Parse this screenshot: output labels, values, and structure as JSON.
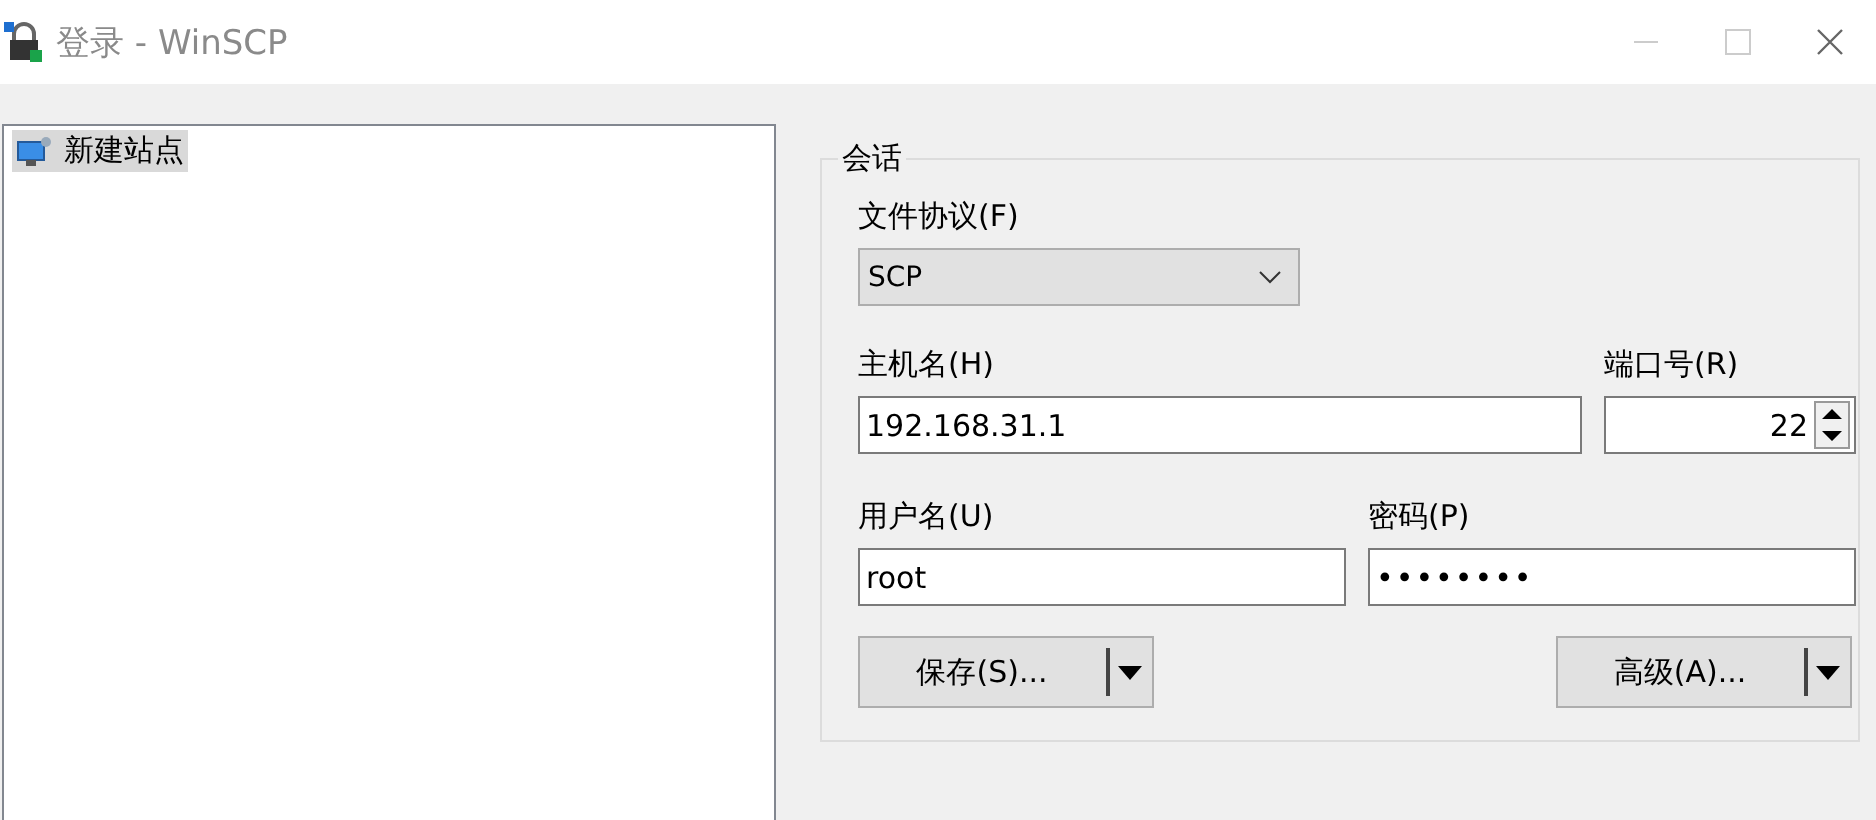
{
  "window": {
    "title": "登录 - WinSCP"
  },
  "sites": [
    {
      "label": "新建站点",
      "selected": true
    }
  ],
  "session": {
    "title": "会话",
    "protocol": {
      "label": "文件协议(F)",
      "value": "SCP"
    },
    "host": {
      "label": "主机名(H)",
      "value": "192.168.31.1"
    },
    "port": {
      "label": "端口号(R)",
      "value": "22"
    },
    "user": {
      "label": "用户名(U)",
      "value": "root"
    },
    "password": {
      "label": "密码(P)",
      "value": "••••••••"
    },
    "buttons": [
      {
        "label": "保存(S)..."
      },
      {
        "label": "高级(A)..."
      }
    ]
  }
}
